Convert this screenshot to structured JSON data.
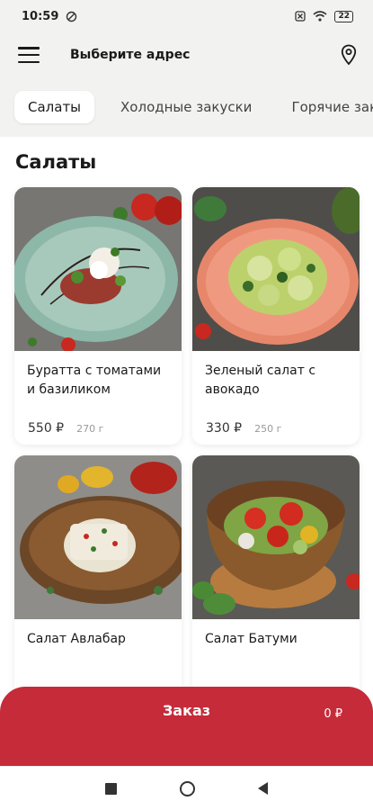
{
  "status": {
    "time": "10:59",
    "battery": "22"
  },
  "header": {
    "address_label": "Выберите адрес"
  },
  "tabs": [
    "Салаты",
    "Холодные закуски",
    "Горячие закуски"
  ],
  "section": {
    "title": "Салаты"
  },
  "products": [
    {
      "name": "Буратта с томатами и базиликом",
      "price": "550 ₽",
      "weight": "270 г"
    },
    {
      "name": "Зеленый салат с авокадо",
      "price": "330 ₽",
      "weight": "250 г"
    },
    {
      "name": "Салат Авлабар",
      "price": "",
      "weight": ""
    },
    {
      "name": "Салат Батуми",
      "price": "",
      "weight": ""
    }
  ],
  "order": {
    "label": "Заказ",
    "total": "0 ₽"
  },
  "colors": {
    "accent": "#c62b3a",
    "background": "#f2f2f0"
  },
  "icons": [
    "menu-icon",
    "location-pin-icon",
    "wifi-icon",
    "battery-icon",
    "home-circle-icon",
    "back-triangle-icon",
    "recents-square-icon"
  ]
}
